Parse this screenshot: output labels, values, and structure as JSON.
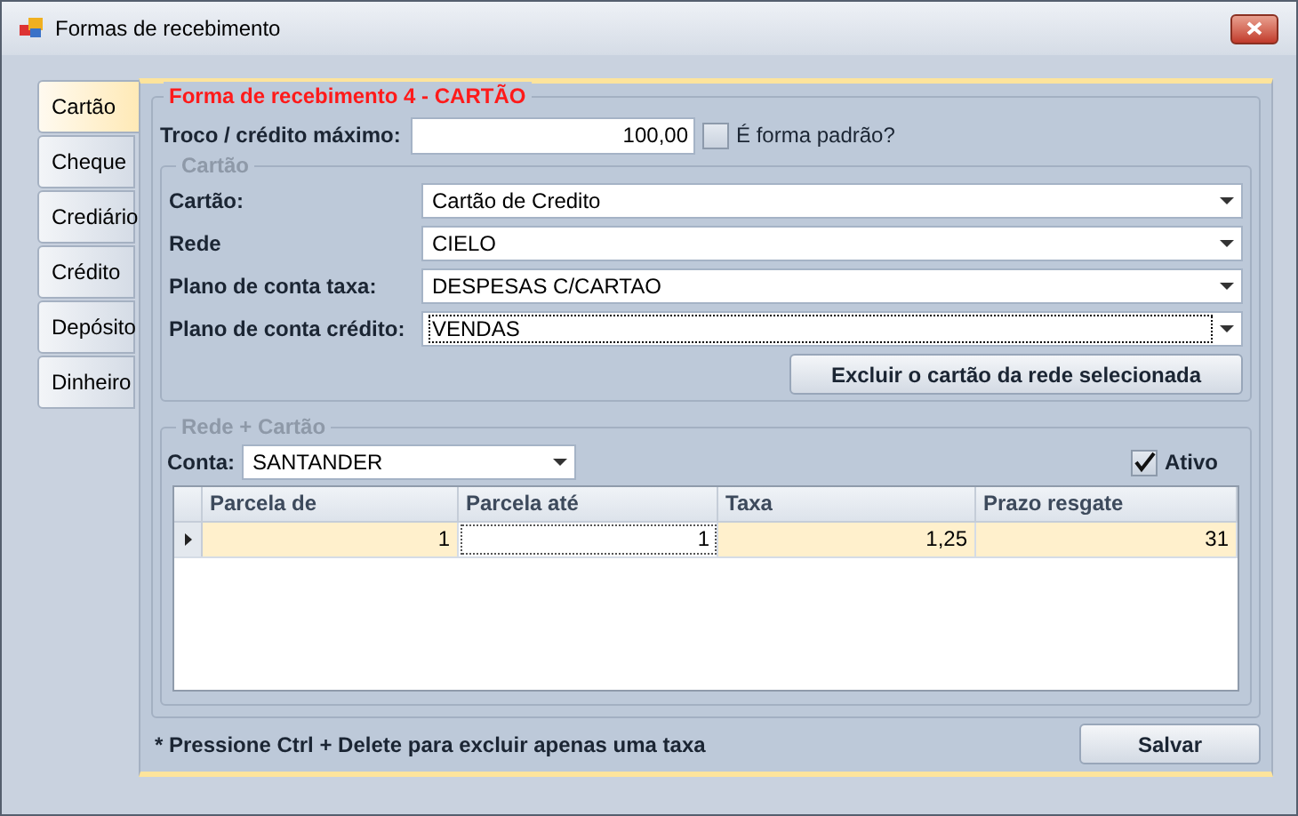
{
  "window": {
    "title": "Formas de recebimento"
  },
  "tabs": [
    {
      "label": "Cartão",
      "selected": true
    },
    {
      "label": "Cheque",
      "selected": false
    },
    {
      "label": "Crediário",
      "selected": false
    },
    {
      "label": "Crédito",
      "selected": false
    },
    {
      "label": "Depósito",
      "selected": false
    },
    {
      "label": "Dinheiro",
      "selected": false
    }
  ],
  "form_title": "Forma de recebimento 4 - CARTÃO",
  "troco": {
    "label": "Troco / crédito máximo:",
    "value": "100,00"
  },
  "default_checkbox": {
    "label": "É forma padrão?",
    "checked": false
  },
  "card_group": {
    "title": "Cartão",
    "fields": [
      {
        "label": "Cartão:",
        "value": "Cartão de Credito",
        "focused": false
      },
      {
        "label": "Rede",
        "value": "CIELO",
        "focused": false
      },
      {
        "label": "Plano de conta taxa:",
        "value": "DESPESAS C/CARTAO",
        "focused": false
      },
      {
        "label": "Plano de conta crédito:",
        "value": "VENDAS",
        "focused": true
      }
    ],
    "button": "Excluir o cartão da rede selecionada"
  },
  "network_group": {
    "title": "Rede + Cartão",
    "account": {
      "label": "Conta:",
      "value": "SANTANDER"
    },
    "active_checkbox": {
      "label": "Ativo",
      "checked": true
    },
    "table": {
      "columns": [
        "Parcela de",
        "Parcela até",
        "Taxa",
        "Prazo resgate"
      ],
      "rows": [
        {
          "selected": true,
          "cells": [
            {
              "text": "1",
              "focused": false
            },
            {
              "text": "1",
              "focused": true
            },
            {
              "text": "1,25",
              "focused": false
            },
            {
              "text": "31",
              "focused": false
            }
          ]
        }
      ]
    }
  },
  "footer_note": "* Pressione Ctrl + Delete para excluir apenas uma taxa",
  "buttons": [
    "Salvar"
  ]
}
